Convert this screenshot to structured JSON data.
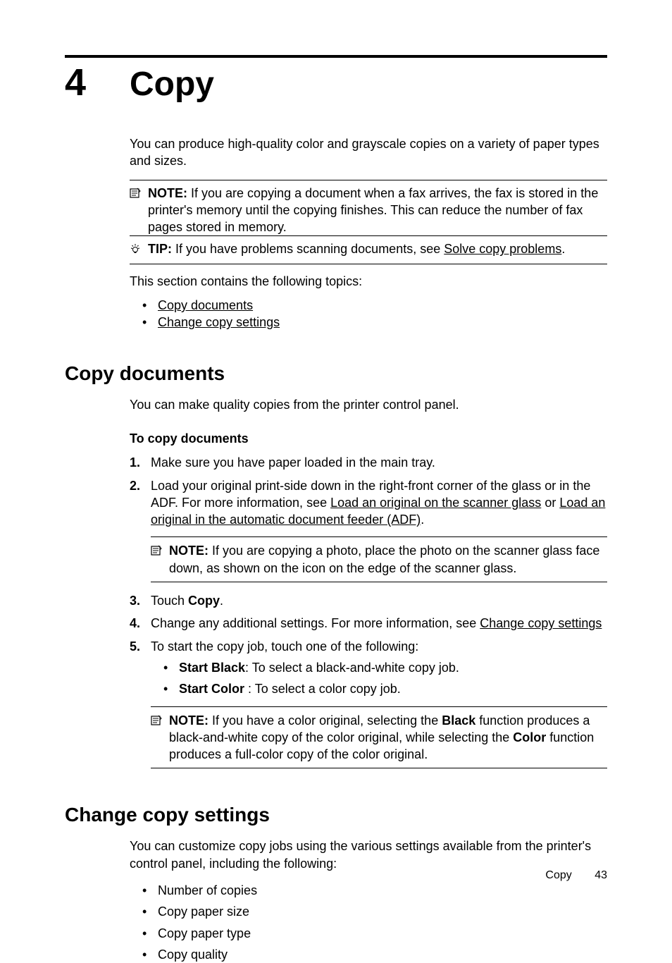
{
  "chapter": {
    "number": "4",
    "title": "Copy"
  },
  "intro": "You can produce high-quality color and grayscale copies on a variety of paper types and sizes.",
  "note1": {
    "label": "NOTE:",
    "text": "If you are copying a document when a fax arrives, the fax is stored in the printer's memory until the copying finishes. This can reduce the number of fax pages stored in memory."
  },
  "tip1": {
    "label": "TIP:",
    "text_before": "If you have problems scanning documents, see ",
    "link": "Solve copy problems",
    "text_after": "."
  },
  "toc_intro": "This section contains the following topics:",
  "toc": [
    "Copy documents",
    "Change copy settings"
  ],
  "section1": {
    "heading": "Copy documents",
    "intro": "You can make quality copies from the printer control panel.",
    "sub_heading": "To copy documents",
    "steps": {
      "s1": "Make sure you have paper loaded in the main tray.",
      "s2_a": "Load your original print-side down in the right-front corner of the glass or in the ADF. For more information, see ",
      "s2_link1": "Load an original on the scanner glass",
      "s2_b": " or ",
      "s2_link2": "Load an original in the automatic document feeder (ADF)",
      "s2_c": ".",
      "s2_note_label": "NOTE:",
      "s2_note": "If you are copying a photo, place the photo on the scanner glass face down, as shown on the icon on the edge of the scanner glass.",
      "s3_a": "Touch ",
      "s3_b": "Copy",
      "s3_c": ".",
      "s4_a": "Change any additional settings. For more information, see ",
      "s4_link": "Change copy settings",
      "s5": "To start the copy job, touch one of the following:",
      "s5_bullet1_a": "Start Black",
      "s5_bullet1_b": ": To select a black-and-white copy job.",
      "s5_bullet2_a": "Start Color",
      "s5_bullet2_b": " : To select a color copy job.",
      "s5_note_label": "NOTE:",
      "s5_note_a": "If you have a color original, selecting the ",
      "s5_note_b": "Black",
      "s5_note_c": " function produces a black-and-white copy of the color original, while selecting the ",
      "s5_note_d": "Color",
      "s5_note_e": " function produces a full-color copy of the color original."
    }
  },
  "section2": {
    "heading": "Change copy settings",
    "intro": "You can customize copy jobs using the various settings available from the printer's control panel, including the following:",
    "items": [
      "Number of copies",
      "Copy paper size",
      "Copy paper type",
      "Copy quality"
    ]
  },
  "footer": {
    "label": "Copy",
    "page": "43"
  }
}
